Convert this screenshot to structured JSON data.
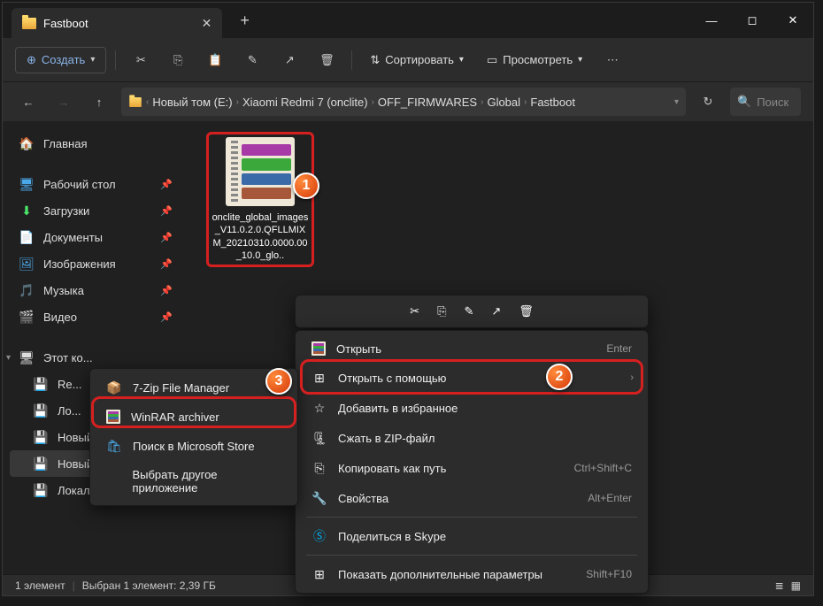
{
  "titlebar": {
    "tab": "Fastboot"
  },
  "toolbar": {
    "create": "Создать",
    "sort": "Сортировать",
    "view": "Просмотреть"
  },
  "breadcrumb": [
    "Новый том (E:)",
    "Xiaomi Redmi 7 (onclite)",
    "OFF_FIRMWARES",
    "Global",
    "Fastboot"
  ],
  "search_placeholder": "Поиск",
  "sidebar": {
    "home": "Главная",
    "quick": [
      "Рабочий стол",
      "Загрузки",
      "Документы",
      "Изображения",
      "Музыка",
      "Видео"
    ],
    "pc": "Этот ко...",
    "drives": [
      "Re...",
      "Ло...",
      "Новый том (D:)",
      "Новый том (E:)",
      "Локальный диск (F:)"
    ]
  },
  "file": {
    "name": "onclite_global_images_V11.0.2.0.QFLLMIXM_20210310.0000.00_10.0_glo.."
  },
  "context_main": {
    "open": "Открыть",
    "open_sc": "Enter",
    "open_with": "Открыть с помощью",
    "fav": "Добавить в избранное",
    "zip": "Сжать в ZIP-файл",
    "copy_path": "Копировать как путь",
    "copy_sc": "Ctrl+Shift+C",
    "props": "Свойства",
    "props_sc": "Alt+Enter",
    "skype": "Поделиться в Skype",
    "more": "Показать дополнительные параметры",
    "more_sc": "Shift+F10"
  },
  "context_sub": {
    "sevenzip": "7-Zip File Manager",
    "winrar": "WinRAR archiver",
    "store": "Поиск в Microsoft Store",
    "other": "Выбрать другое приложение"
  },
  "status": {
    "count": "1 элемент",
    "sel": "Выбран 1 элемент: 2,39 ГБ"
  }
}
